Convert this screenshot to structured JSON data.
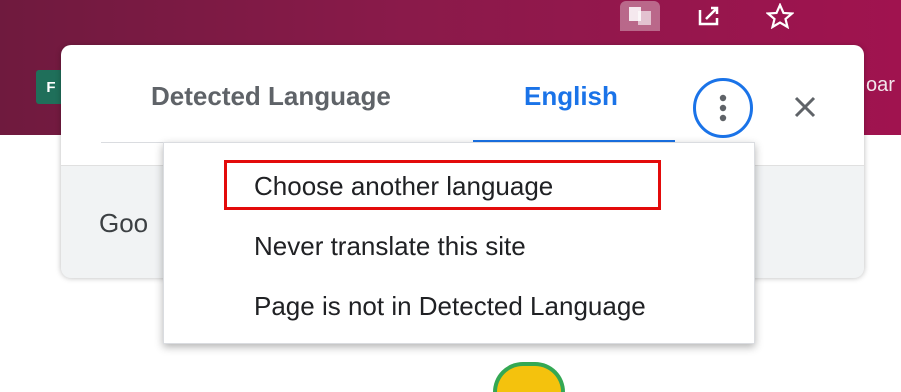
{
  "bubble": {
    "tabs": [
      {
        "label": "Detected Language",
        "selected": false
      },
      {
        "label": "English",
        "selected": true
      }
    ],
    "body_text": "Goo"
  },
  "chrome": {
    "left_fragment": "F",
    "right_fragment": "oar"
  },
  "menu": {
    "items": [
      {
        "label": "Choose another language",
        "highlighted": true
      },
      {
        "label": "Never translate this site"
      },
      {
        "label": "Page is not in Detected Language"
      }
    ]
  },
  "icons": {
    "translate": "translate-icon",
    "share": "share-icon",
    "bookmark": "star-icon",
    "more": "more-vertical-icon",
    "close": "close-icon"
  },
  "colors": {
    "accent": "#1a73e8",
    "highlight": "#e30b0b",
    "chrome": "#8a1a4a"
  }
}
